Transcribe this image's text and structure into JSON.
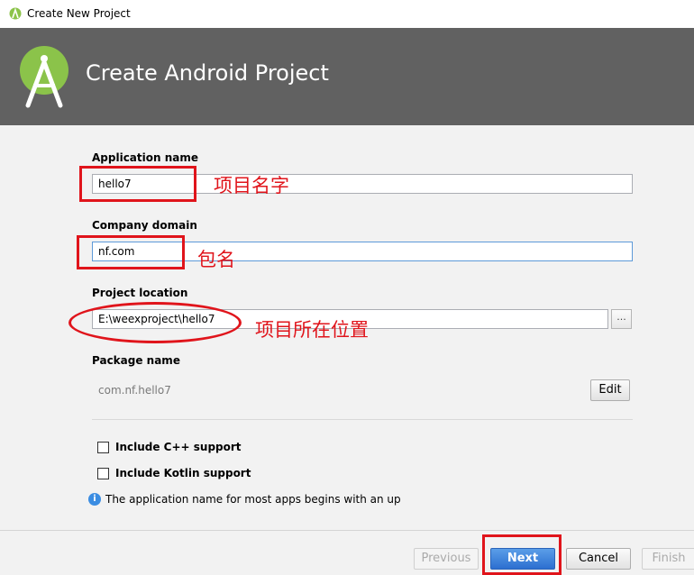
{
  "window": {
    "title": "Create New Project"
  },
  "banner": {
    "heading": "Create Android Project"
  },
  "form": {
    "app_name_label": "Application name",
    "app_name_value": "hello7",
    "company_label": "Company domain",
    "company_value": "nf.com",
    "location_label": "Project location",
    "location_value": "E:\\weexproject\\hello7",
    "browse_label": "...",
    "package_label": "Package name",
    "package_value": "com.nf.hello7",
    "edit_label": "Edit",
    "cpp_label": "Include C++ support",
    "cpp_checked": false,
    "kotlin_label": "Include Kotlin support",
    "kotlin_checked": false,
    "info_text": "The application name for most apps begins with an up"
  },
  "footer": {
    "previous_label": "Previous",
    "next_label": "Next",
    "cancel_label": "Cancel",
    "finish_label": "Finish"
  },
  "annotations": {
    "app_name_note": "项目名字",
    "company_note": "包名",
    "location_note": "项目所在位置"
  },
  "colors": {
    "accent": "#2c6fd0",
    "annotation": "#e0141b",
    "banner": "#616161",
    "logo": "#8bc34a"
  }
}
